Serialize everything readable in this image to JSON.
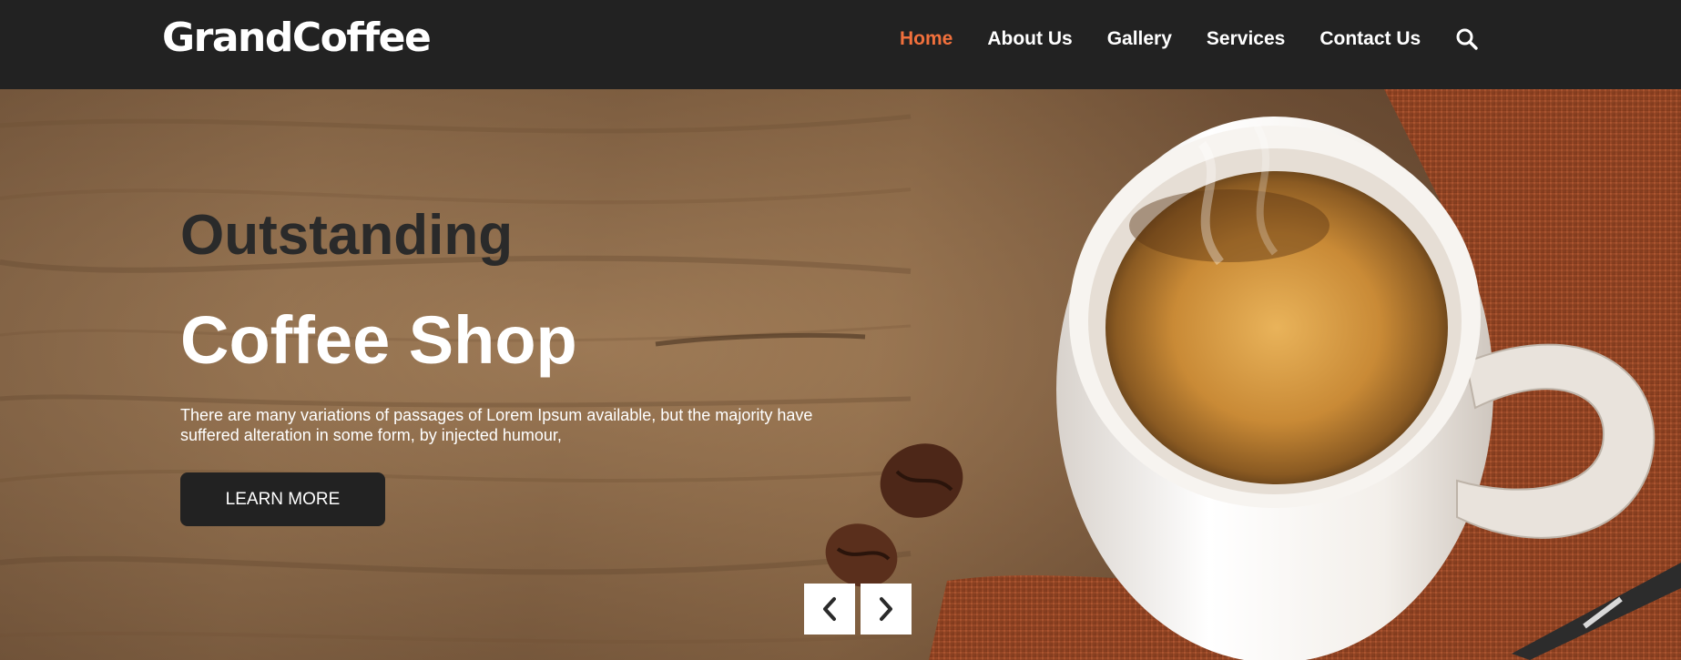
{
  "brand": {
    "name": "GrandCoffee"
  },
  "nav": {
    "items": [
      {
        "label": "Home",
        "active": true
      },
      {
        "label": "About Us",
        "active": false
      },
      {
        "label": "Gallery",
        "active": false
      },
      {
        "label": "Services",
        "active": false
      },
      {
        "label": "Contact Us",
        "active": false
      }
    ],
    "search_icon": "search-icon"
  },
  "hero": {
    "title_line1": "Outstanding",
    "title_line2": "Coffee Shop",
    "description": "There are many variations of passages of Lorem Ipsum available, but the majority have suffered alteration in some form, by injected humour,",
    "cta_label": "LEARN MORE",
    "prev_icon": "chevron-left-icon",
    "next_icon": "chevron-right-icon",
    "image_subject": "coffee-cup-image"
  },
  "colors": {
    "header_bg": "#222222",
    "accent": "#f1703c",
    "button_bg": "#222222",
    "text_light": "#ffffff",
    "text_dark": "#2a2a2a"
  }
}
